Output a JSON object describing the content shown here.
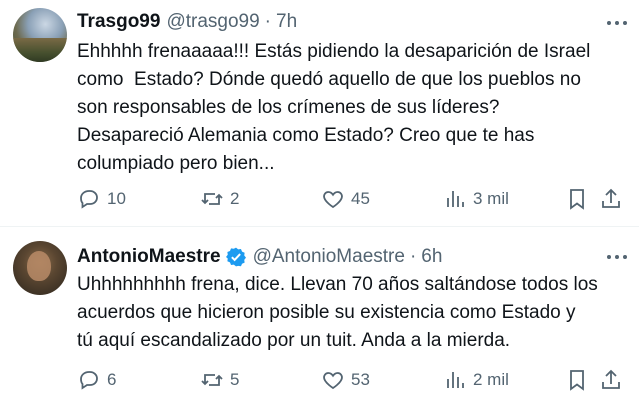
{
  "tweets": [
    {
      "name": "Trasgo99",
      "handle": "@trasgo99",
      "separator": "·",
      "time": "7h",
      "verified": false,
      "text_lines": [
        "Ehhhhh frenaaaaa!!! Estás pidiendo la desaparición de Israel",
        "como  Estado? Dónde quedó aquello de que los pueblos no",
        "son responsables de los crímenes de sus líderes?",
        "Desapareció Alemania como Estado? Creo que te has",
        "columpiado pero bien..."
      ],
      "actions": {
        "replies": "10",
        "reposts": "2",
        "likes": "45",
        "views": "3 mil"
      }
    },
    {
      "name": "AntonioMaestre",
      "handle": "@AntonioMaestre",
      "separator": "·",
      "time": "6h",
      "verified": true,
      "text_lines": [
        "Uhhhhhhhhh frena, dice. Llevan 70 años saltándose todos los",
        "acuerdos que hicieron posible su existencia como Estado y",
        "tú aquí escandalizado por un tuit. Anda a la mierda."
      ],
      "actions": {
        "replies": "6",
        "reposts": "5",
        "likes": "53",
        "views": "2 mil"
      }
    }
  ],
  "icons": {
    "reply": "reply-icon",
    "repost": "repost-icon",
    "like": "heart-icon",
    "views": "views-icon",
    "bookmark": "bookmark-icon",
    "share": "share-icon",
    "more": "more-icon",
    "verified": "verified-badge-icon"
  },
  "colors": {
    "text": "#0f1419",
    "secondary": "#536471",
    "verified": "#1d9bf0",
    "divider": "#eff3f4"
  }
}
